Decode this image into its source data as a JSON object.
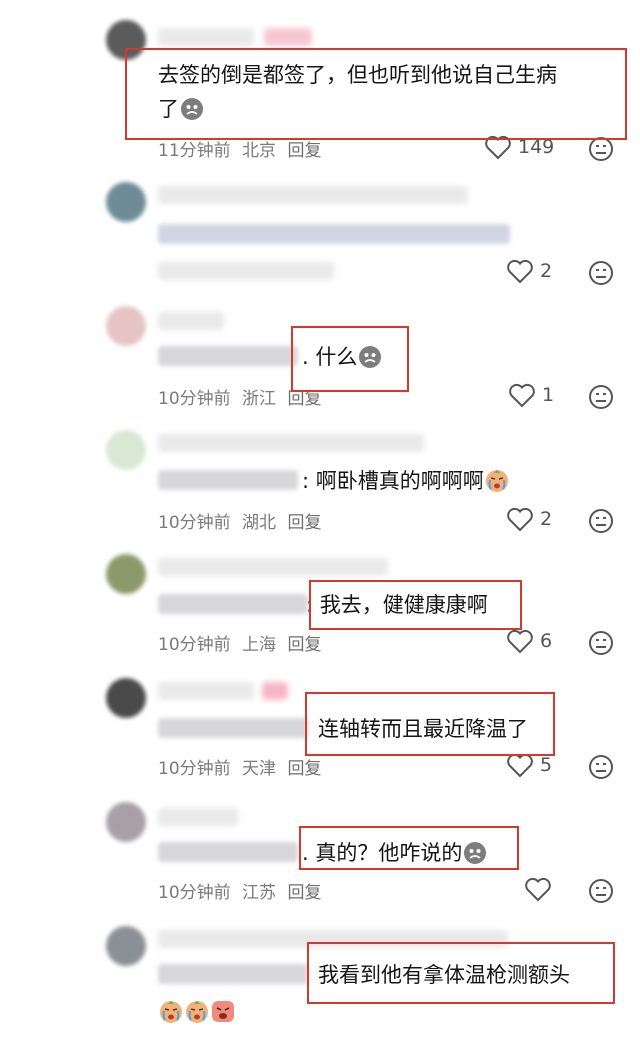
{
  "comments": [
    {
      "text": "去签的倒是都签了，但也听到他说自己生病",
      "text2": "了",
      "emoji": "ghost-bag-icon",
      "time": "11分钟前",
      "location": "北京",
      "reply": "回复",
      "likes": "149"
    },
    {
      "time": "",
      "location": "",
      "reply": "",
      "likes": "2"
    },
    {
      "text": ". 什么",
      "emoji": "ghost-bag-icon",
      "time": "10分钟前",
      "location": "浙江",
      "reply": "回复",
      "likes": "1"
    },
    {
      "text": ": 啊卧槽真的啊啊啊",
      "emoji": "crying-face-icon",
      "time": "10分钟前",
      "location": "湖北",
      "reply": "回复",
      "likes": "2"
    },
    {
      "text": ": 我去，健健康康啊",
      "time": "10分钟前",
      "location": "上海",
      "reply": "回复",
      "likes": "6"
    },
    {
      "text": "连轴转而且最近降温了",
      "time": "10分钟前",
      "location": "天津",
      "reply": "回复",
      "likes": "5"
    },
    {
      "text": ". 真的？他咋说的",
      "emoji": "ghost-bag-icon",
      "time": "10分钟前",
      "location": "江苏",
      "reply": "回复",
      "likes": ""
    },
    {
      "text": "我看到他有拿体温枪测额头",
      "emojis": [
        "crying-face-icon",
        "crying-face-icon",
        "sobbing-face-icon"
      ]
    }
  ],
  "colors": {
    "highlight_box": "#d23a2f",
    "meta_text": "#7a7a7a"
  }
}
